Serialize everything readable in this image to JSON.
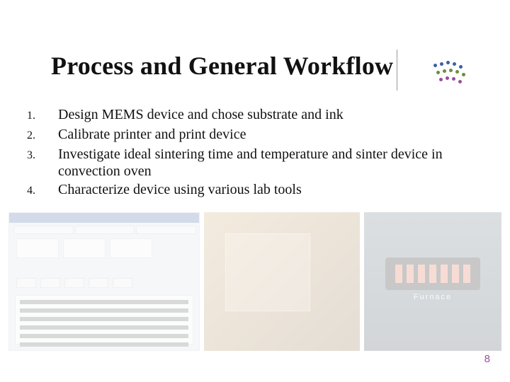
{
  "title": "Process and General Workflow",
  "items": [
    {
      "num": "1.",
      "text": "Design MEMS device and chose substrate and ink"
    },
    {
      "num": "2.",
      "text": "Calibrate printer and print device"
    },
    {
      "num": "3.",
      "text": "Investigate ideal sintering time and temperature and sinter device in convection oven"
    },
    {
      "num": "4.",
      "text": "Characterize device using various lab tools"
    }
  ],
  "furnace_label": "Furnace",
  "page_number": "8"
}
